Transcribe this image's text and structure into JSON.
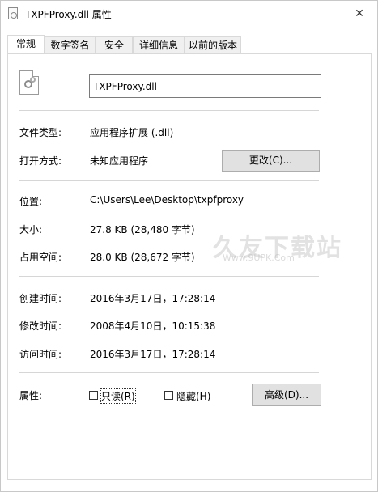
{
  "window": {
    "title": "TXPFProxy.dll 属性",
    "close_glyph": "✕"
  },
  "tabs": [
    {
      "label": "常规",
      "active": true
    },
    {
      "label": "数字签名",
      "active": false
    },
    {
      "label": "安全",
      "active": false
    },
    {
      "label": "详细信息",
      "active": false
    },
    {
      "label": "以前的版本",
      "active": false
    }
  ],
  "general": {
    "file_icon": "dll-file-gear-icon",
    "file_name": "TXPFProxy.dll",
    "file_type_label": "文件类型:",
    "file_type_value": "应用程序扩展 (.dll)",
    "opens_with_label": "打开方式:",
    "opens_with_value": "未知应用程序",
    "change_button": "更改(C)...",
    "location_label": "位置:",
    "location_value": "C:\\Users\\Lee\\Desktop\\txpfproxy",
    "size_label": "大小:",
    "size_value": "27.8 KB (28,480 字节)",
    "size_on_disk_label": "占用空间:",
    "size_on_disk_value": "28.0 KB (28,672 字节)",
    "created_label": "创建时间:",
    "created_value": "2016年3月17日，17:28:14",
    "modified_label": "修改时间:",
    "modified_value": "2008年4月10日，10:15:38",
    "accessed_label": "访问时间:",
    "accessed_value": "2016年3月17日，17:28:14",
    "attributes_label": "属性:",
    "readonly_label": "只读(R)",
    "readonly_checked": false,
    "hidden_label": "隐藏(H)",
    "hidden_checked": false,
    "advanced_button": "高级(D)..."
  },
  "watermark": {
    "text": "久友下载站",
    "url": "Www.9UPK.Com"
  }
}
